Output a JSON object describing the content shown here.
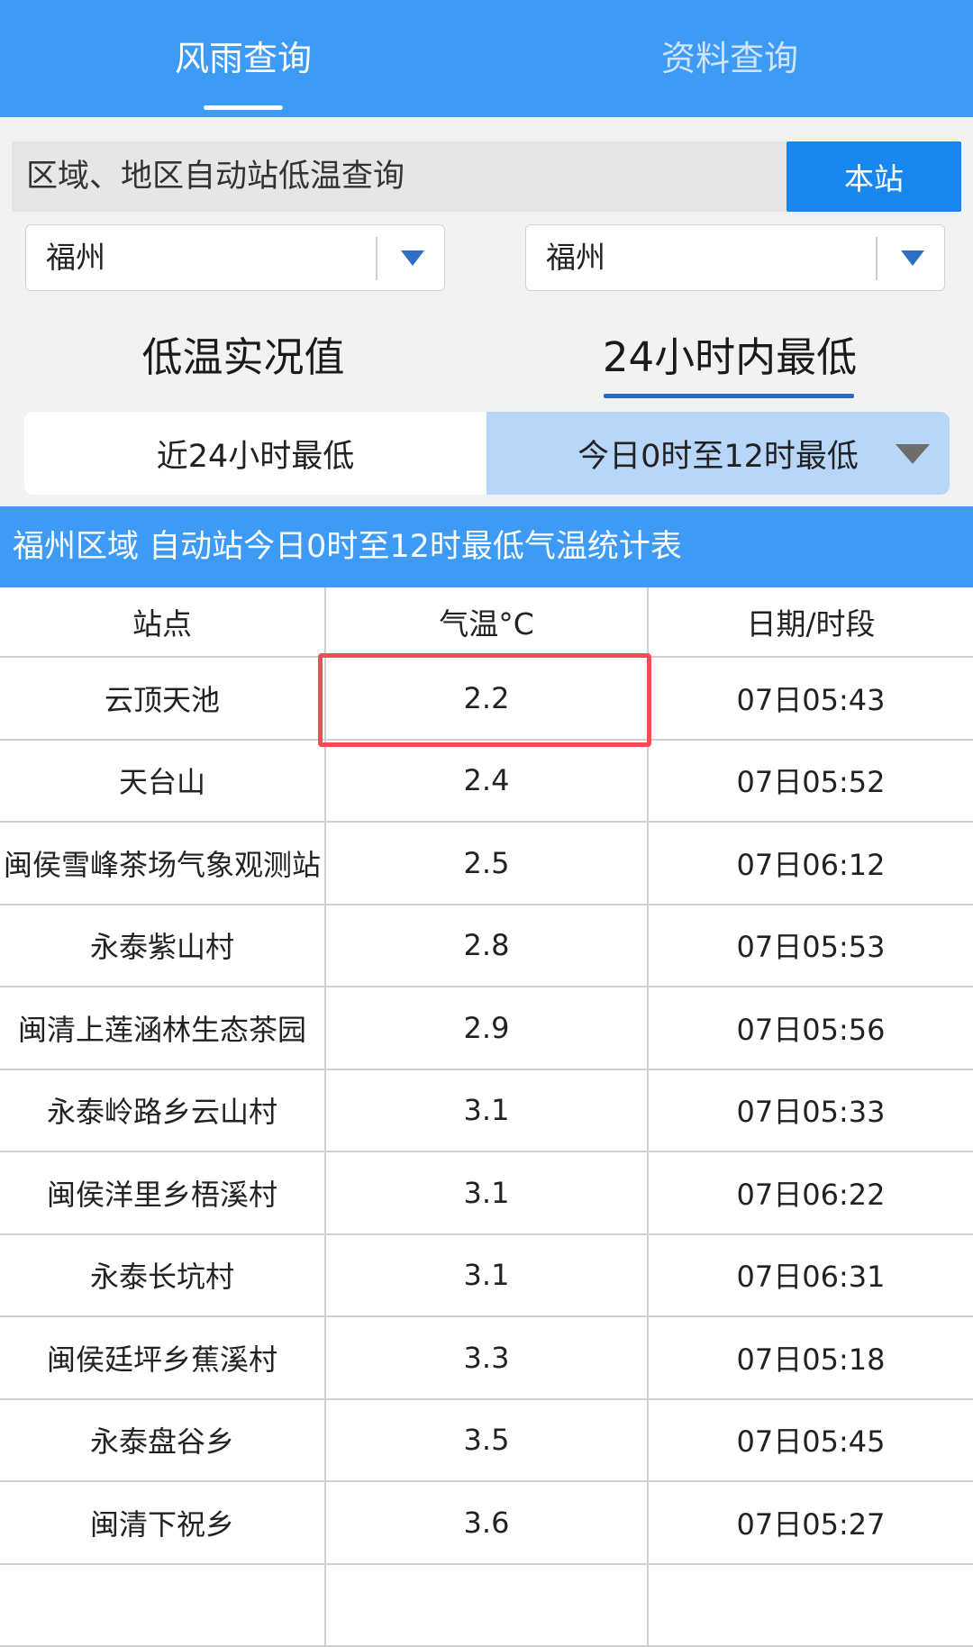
{
  "top_tabs": [
    {
      "label": "风雨查询",
      "active": true
    },
    {
      "label": "资料查询",
      "active": false
    }
  ],
  "query": {
    "title": "区域、地区自动站低温查询",
    "station_button": "本站"
  },
  "selects": [
    {
      "value": "福州"
    },
    {
      "value": "福州"
    }
  ],
  "modes": [
    {
      "label": "低温实况值",
      "active": false
    },
    {
      "label": "24小时内最低",
      "active": true
    }
  ],
  "sub_tabs": [
    {
      "label": "近24小时最低",
      "active": false
    },
    {
      "label": "今日0时至12时最低",
      "active": true
    }
  ],
  "table_title": "福州区域 自动站今日0时至12时最低气温统计表",
  "table": {
    "headers": [
      "站点",
      "气温°C",
      "日期/时段"
    ],
    "rows": [
      [
        "云顶天池",
        "2.2",
        "07日05:43"
      ],
      [
        "天台山",
        "2.4",
        "07日05:52"
      ],
      [
        "闽侯雪峰茶场气象观测站",
        "2.5",
        "07日06:12"
      ],
      [
        "永泰紫山村",
        "2.8",
        "07日05:53"
      ],
      [
        "闽清上莲涵林生态茶园",
        "2.9",
        "07日05:56"
      ],
      [
        "永泰岭路乡云山村",
        "3.1",
        "07日05:33"
      ],
      [
        "闽侯洋里乡梧溪村",
        "3.1",
        "07日06:22"
      ],
      [
        "永泰长坑村",
        "3.1",
        "07日06:31"
      ],
      [
        "闽侯廷坪乡蕉溪村",
        "3.3",
        "07日05:18"
      ],
      [
        "永泰盘谷乡",
        "3.5",
        "07日05:45"
      ],
      [
        "闽清下祝乡",
        "3.6",
        "07日05:27"
      ],
      [
        "",
        "",
        ""
      ]
    ]
  },
  "colors": {
    "primary_blue": "#3d9bf5",
    "button_blue": "#1a87ee",
    "active_subtab": "#b8d7f8",
    "highlight_red": "#f04e55"
  }
}
